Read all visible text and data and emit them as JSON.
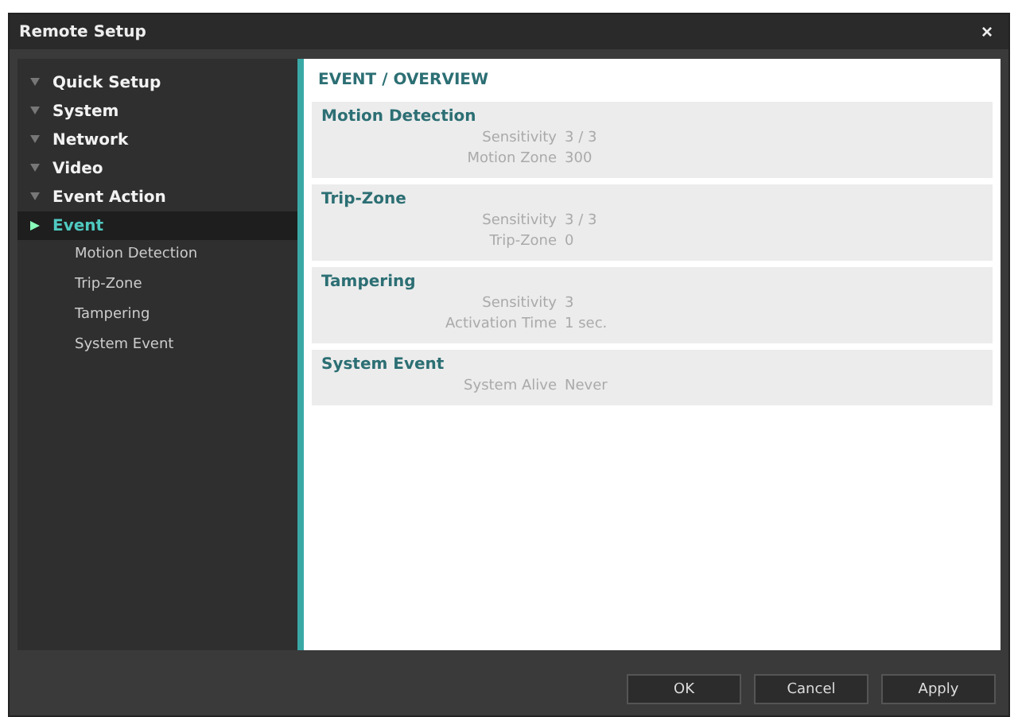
{
  "window": {
    "title": "Remote Setup",
    "close": "×"
  },
  "sidebar": {
    "items": [
      {
        "label": "Quick Setup",
        "selected": false,
        "expanded": false
      },
      {
        "label": "System",
        "selected": false,
        "expanded": false
      },
      {
        "label": "Network",
        "selected": false,
        "expanded": false
      },
      {
        "label": "Video",
        "selected": false,
        "expanded": false
      },
      {
        "label": "Event Action",
        "selected": false,
        "expanded": false
      },
      {
        "label": "Event",
        "selected": true,
        "expanded": true,
        "children": [
          {
            "label": "Motion Detection",
            "selected": false
          },
          {
            "label": "Trip-Zone",
            "selected": false
          },
          {
            "label": "Tampering",
            "selected": false
          },
          {
            "label": "System Event",
            "selected": false
          }
        ]
      }
    ]
  },
  "content": {
    "heading": "EVENT / OVERVIEW",
    "sections": [
      {
        "title": "Motion Detection",
        "rows": [
          {
            "label": "Sensitivity",
            "value": "3 / 3"
          },
          {
            "label": "Motion Zone",
            "value": "300"
          }
        ]
      },
      {
        "title": "Trip-Zone",
        "rows": [
          {
            "label": "Sensitivity",
            "value": "3 / 3"
          },
          {
            "label": "Trip-Zone",
            "value": "0"
          }
        ]
      },
      {
        "title": "Tampering",
        "rows": [
          {
            "label": "Sensitivity",
            "value": "3"
          },
          {
            "label": "Activation Time",
            "value": "1 sec."
          }
        ]
      },
      {
        "title": "System Event",
        "rows": [
          {
            "label": "System Alive",
            "value": "Never"
          }
        ]
      }
    ]
  },
  "buttons": [
    "OK",
    "Cancel",
    "Apply"
  ]
}
